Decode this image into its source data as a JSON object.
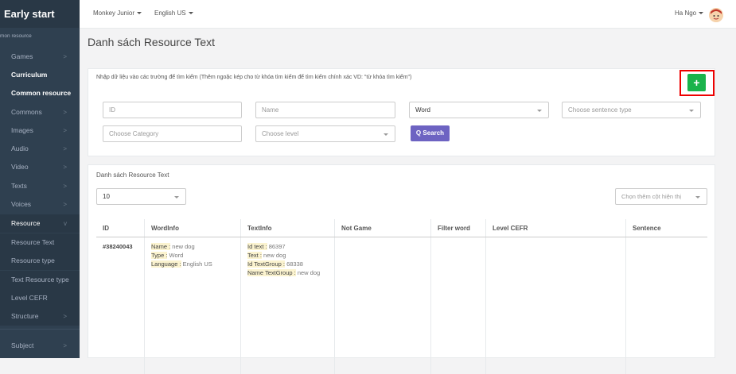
{
  "brand": "Early start",
  "sidebar": {
    "section_label": "mon resource",
    "items": [
      {
        "label": "Games",
        "chevron": ">"
      },
      {
        "label": "Curriculum",
        "chevron": ""
      },
      {
        "label": "Common resource",
        "chevron": ""
      },
      {
        "label": "Commons",
        "chevron": ">"
      },
      {
        "label": "Images",
        "chevron": ">"
      },
      {
        "label": "Audio",
        "chevron": ">"
      },
      {
        "label": "Video",
        "chevron": ">"
      },
      {
        "label": "Texts",
        "chevron": ">"
      },
      {
        "label": "Voices",
        "chevron": ">"
      },
      {
        "label": "Resource",
        "chevron": "v"
      },
      {
        "label": "Resource Text",
        "chevron": ""
      },
      {
        "label": "Resource type",
        "chevron": ""
      },
      {
        "label": "Text Resource type",
        "chevron": ""
      },
      {
        "label": "Level CEFR",
        "chevron": ""
      },
      {
        "label": "Structure",
        "chevron": ">"
      },
      {
        "label": "Subject",
        "chevron": ">"
      }
    ]
  },
  "topbar": {
    "product": "Monkey Junior",
    "language": "English US",
    "user": "Ha Ngo"
  },
  "page_title": "Danh sách Resource Text",
  "search": {
    "hint": "Nhập dữ liệu vào các trường để tìm kiếm (Thêm ngoặc kép cho từ khóa tìm kiếm để tìm kiếm chính xác VD: \"từ khóa tìm kiếm\")",
    "add_label": "+",
    "id_placeholder": "ID",
    "name_placeholder": "Name",
    "type_value": "Word",
    "sentence_type_placeholder": "Choose sentence type",
    "category_placeholder": "Choose Category",
    "level_placeholder": "Choose level",
    "search_label": "Q Search"
  },
  "list": {
    "title": "Danh sách Resource Text",
    "page_size": "10",
    "column_chooser": "Chọn thêm cột hiện thị",
    "columns": [
      "ID",
      "WordInfo",
      "TextInfo",
      "Not Game",
      "Filter word",
      "Level CEFR",
      "Sentence"
    ],
    "rows": [
      {
        "id": "#38240043",
        "wordinfo": {
          "name_key": "Name :",
          "name_val": "new dog",
          "type_key": "Type :",
          "type_val": "Word",
          "lang_key": "Language :",
          "lang_val": "English US"
        },
        "textinfo": {
          "id_key": "Id text :",
          "id_val": "86397",
          "text_key": "Text :",
          "text_val": "new dog",
          "group_key": "Id TextGroup :",
          "group_val": "68338",
          "gname_key": "Name TextGroup :",
          "gname_val": "new dog"
        },
        "not_game": "",
        "filter_word": "",
        "level_cefr": "",
        "sentence": ""
      }
    ]
  }
}
